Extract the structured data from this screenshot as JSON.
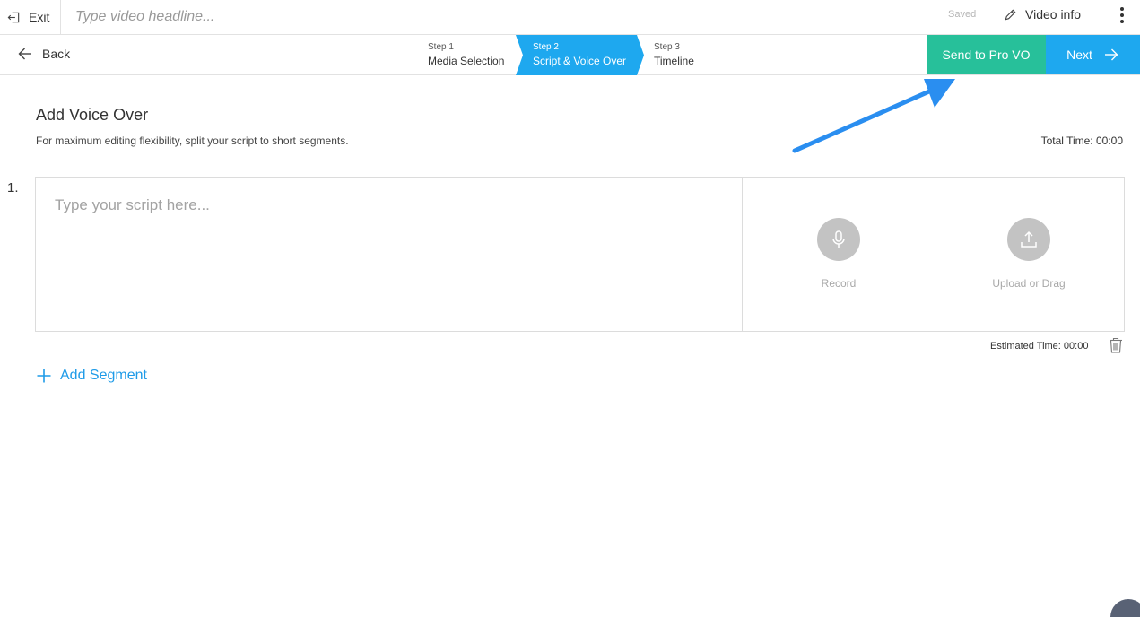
{
  "topbar": {
    "exit_label": "Exit",
    "headline_placeholder": "Type video headline...",
    "saved_text": "Saved",
    "video_info_label": "Video info"
  },
  "steps_bar": {
    "back_label": "Back",
    "steps": [
      {
        "num": "Step 1",
        "name": "Media Selection",
        "active": false
      },
      {
        "num": "Step 2",
        "name": "Script & Voice Over",
        "active": true
      },
      {
        "num": "Step 3",
        "name": "Timeline",
        "active": false
      }
    ],
    "send_pro_label": "Send to Pro VO",
    "next_label": "Next"
  },
  "main": {
    "title": "Add Voice Over",
    "subtitle": "For maximum editing flexibility, split your script to short segments.",
    "total_time": "Total Time: 00:00",
    "segments": [
      {
        "number": "1.",
        "script_placeholder": "Type your script here...",
        "record_label": "Record",
        "upload_label": "Upload or Drag",
        "estimated_time": "Estimated Time: 00:00"
      }
    ],
    "add_segment_label": "Add Segment"
  },
  "colors": {
    "green": "#27c09a",
    "blue": "#1ea8ef",
    "link_blue": "#1e9be8",
    "annotation_arrow": "#2a8ef0"
  },
  "icons": {
    "exit": "exit-door-icon",
    "video_info": "pencil-icon",
    "menu": "kebab-menu-icon",
    "back": "arrow-left-icon",
    "next": "arrow-right-icon",
    "record": "microphone-icon",
    "upload": "upload-icon",
    "delete": "trash-icon",
    "add": "plus-icon"
  }
}
